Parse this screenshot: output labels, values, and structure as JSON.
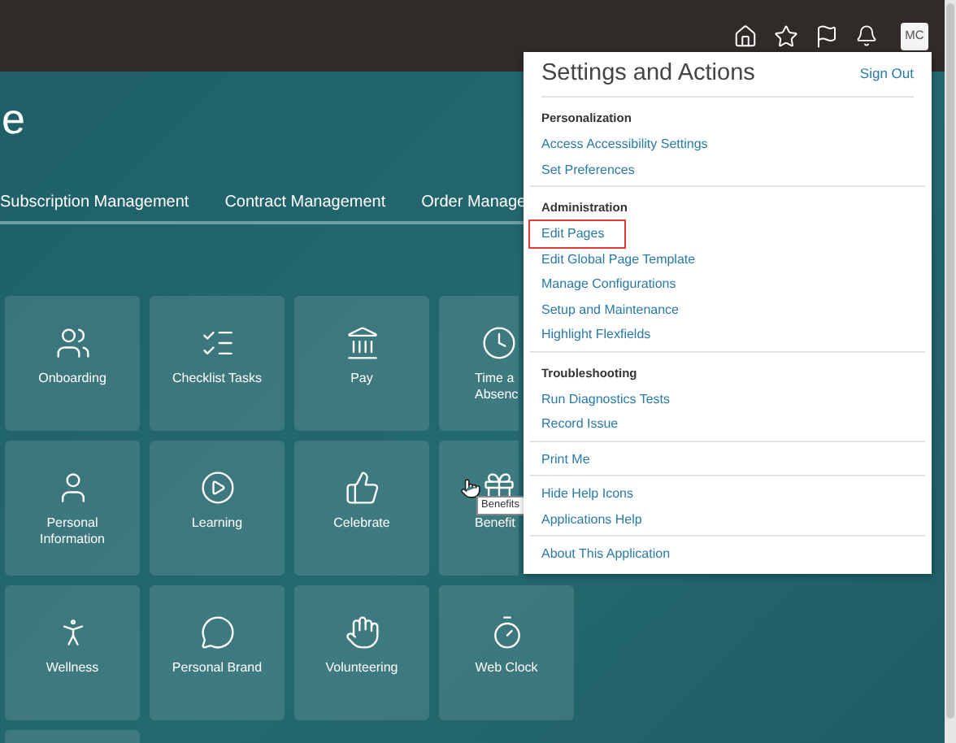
{
  "header": {
    "avatar": "MC"
  },
  "page": {
    "title": "e",
    "nav": [
      "Subscription Management",
      "Contract Management",
      "Order Manage"
    ]
  },
  "tiles": [
    {
      "label": "Onboarding"
    },
    {
      "label": "Checklist Tasks"
    },
    {
      "label": "Pay"
    },
    {
      "label": "Time a\nAbsenc"
    },
    {
      "label": "Personal Information"
    },
    {
      "label": "Learning"
    },
    {
      "label": "Celebrate"
    },
    {
      "label": "Benefit"
    },
    {
      "label": "Wellness"
    },
    {
      "label": "Personal Brand"
    },
    {
      "label": "Volunteering"
    },
    {
      "label": "Web Clock"
    }
  ],
  "tooltip": "Benefits",
  "menu": {
    "title": "Settings and Actions",
    "sign_out": "Sign Out",
    "sections": [
      {
        "heading": "Personalization",
        "items": [
          {
            "label": "Access Accessibility Settings",
            "highlighted": false
          },
          {
            "label": "Set Preferences",
            "highlighted": false
          }
        ]
      },
      {
        "heading": "Administration",
        "items": [
          {
            "label": "Edit Pages",
            "highlighted": true
          },
          {
            "label": "Edit Global Page Template",
            "highlighted": false
          },
          {
            "label": "Manage Configurations",
            "highlighted": false
          },
          {
            "label": "Setup and Maintenance",
            "highlighted": false
          },
          {
            "label": "Highlight Flexfields",
            "highlighted": false
          }
        ]
      },
      {
        "heading": "Troubleshooting",
        "items": [
          {
            "label": "Run Diagnostics Tests",
            "highlighted": false
          },
          {
            "label": "Record Issue",
            "highlighted": false
          }
        ]
      },
      {
        "items": [
          {
            "label": "Print Me",
            "highlighted": false
          }
        ]
      },
      {
        "items": [
          {
            "label": "Hide Help Icons",
            "highlighted": false
          },
          {
            "label": "Applications Help",
            "highlighted": false
          }
        ]
      },
      {
        "items": [
          {
            "label": "About This Application",
            "highlighted": false
          }
        ]
      }
    ]
  }
}
